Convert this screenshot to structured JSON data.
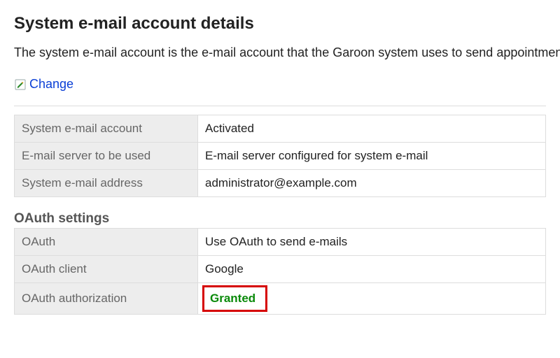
{
  "page": {
    "title": "System e-mail account details",
    "intro": "The system e-mail account is the e-mail account that the Garoon system uses to send appointments."
  },
  "actions": {
    "change_label": "Change"
  },
  "account": {
    "rows": [
      {
        "label": "System e-mail account",
        "value": "Activated"
      },
      {
        "label": "E-mail server to be used",
        "value": "E-mail server configured for system e-mail"
      },
      {
        "label": "System e-mail address",
        "value": "administrator@example.com"
      }
    ]
  },
  "oauth": {
    "heading": "OAuth settings",
    "rows": [
      {
        "label": "OAuth",
        "value": "Use OAuth to send e-mails"
      },
      {
        "label": "OAuth client",
        "value": "Google"
      },
      {
        "label": "OAuth authorization",
        "value": "Granted",
        "highlighted": true
      }
    ]
  }
}
